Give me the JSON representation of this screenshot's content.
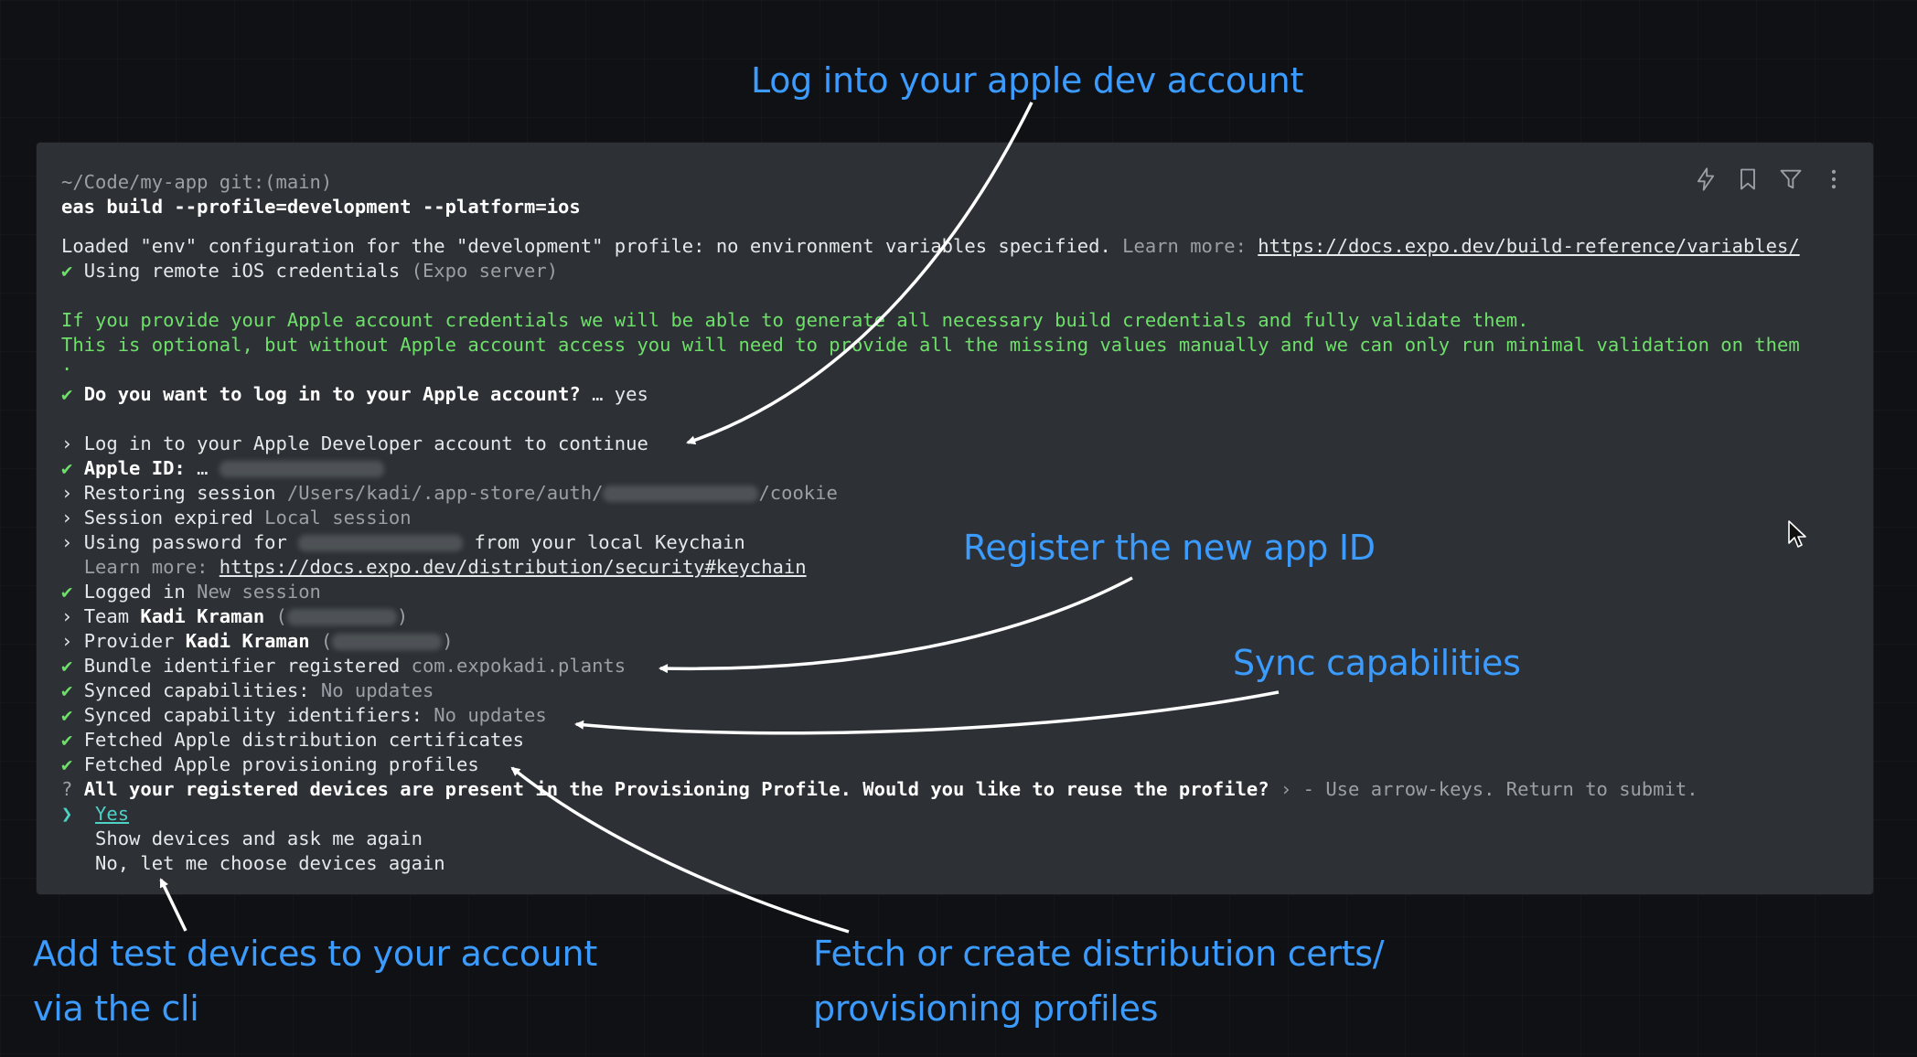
{
  "annotations": {
    "login": "Log into your apple dev account",
    "register": "Register the new app ID",
    "sync": "Sync capabilities",
    "devices_line1": "Add test devices to your account",
    "devices_line2": "via the cli",
    "certs_line1": "Fetch or create distribution certs/",
    "certs_line2": "provisioning profiles"
  },
  "terminal": {
    "prompt": "~/Code/my-app git:(main)",
    "command": "eas build --profile=development --platform=ios",
    "loaded": "Loaded \"env\" configuration for the \"development\" profile: no environment variables specified.",
    "learn_more_label": "Learn more:",
    "learn_more_url": "https://docs.expo.dev/build-reference/variables/",
    "check": "✔",
    "chevron": "›",
    "remote_creds": "Using remote iOS credentials",
    "expo_server": "(Expo server)",
    "info_line1": "If you provide your Apple account credentials we will be able to generate all necessary build credentials and fully validate them.",
    "info_line2": "This is optional, but without Apple account access you will need to provide all the missing values manually and we can only run minimal validation on them",
    "info_line3": ".",
    "login_question": "Do you want to log in to your Apple account?",
    "login_answer": "… yes",
    "login_continue": "Log in to your Apple Developer account to continue",
    "apple_id_label": "Apple ID:",
    "apple_id_ellipsis": "…",
    "restoring": "Restoring session",
    "restoring_path_start": "/Users/kadi/.app-store/auth/",
    "restoring_path_end": "/cookie",
    "session_expired": "Session expired",
    "local_session": "Local session",
    "using_password": "Using password for",
    "from_keychain": "from your local Keychain",
    "keychain_learn_label": "Learn more:",
    "keychain_url": "https://docs.expo.dev/distribution/security#keychain",
    "logged_in": "Logged in",
    "new_session": "New session",
    "team_label": "Team",
    "team_name": "Kadi Kraman",
    "provider_label": "Provider",
    "provider_name": "Kadi Kraman",
    "paren_open": "(",
    "paren_close": ")",
    "bundle_registered": "Bundle identifier registered",
    "bundle_id": "com.expokadi.plants",
    "synced_caps": "Synced capabilities:",
    "no_updates_1": "No updates",
    "synced_cap_ids": "Synced capability identifiers:",
    "no_updates_2": "No updates",
    "fetched_certs": "Fetched Apple distribution certificates",
    "fetched_profiles": "Fetched Apple provisioning profiles",
    "question_mark": "?",
    "reuse_question": "All your registered devices are present in the Provisioning Profile. Would you like to reuse the profile?",
    "reuse_hint": "› - Use arrow-keys. Return to submit.",
    "selector": "❯",
    "options": [
      "Yes",
      "Show devices and ask me again",
      "No, let me choose devices again"
    ]
  },
  "toolbar": {
    "icons": [
      "lightning-icon",
      "bookmark-icon",
      "filter-icon",
      "more-vertical-icon"
    ]
  },
  "colors": {
    "annotation": "#3b9bff",
    "terminal_bg": "#2d3135",
    "success_green": "#6ee06a",
    "selected_cyan": "#4fd1c5"
  }
}
